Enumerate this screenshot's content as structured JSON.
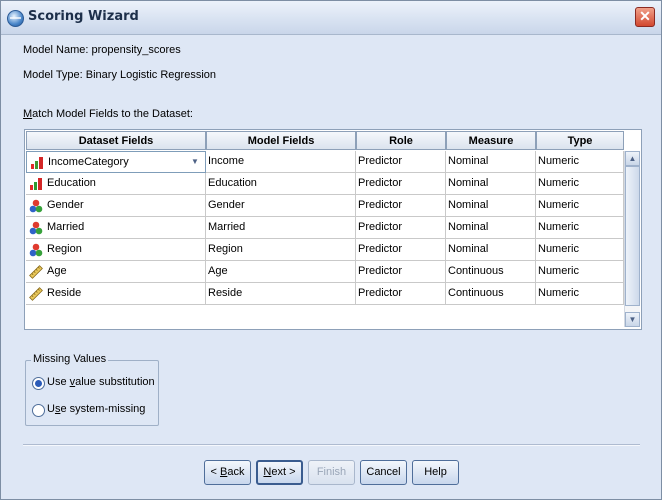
{
  "window": {
    "title": "Scoring Wizard",
    "close_label": "✕"
  },
  "info": {
    "model_name": "Model Name: propensity_scores",
    "model_type": "Model Type: Binary Logistic Regression",
    "match_prefix": "",
    "match_underlined": "M",
    "match_rest": "atch Model Fields to the Dataset:"
  },
  "table": {
    "headers": [
      "Dataset Fields",
      "Model Fields",
      "Role",
      "Measure",
      "Type"
    ],
    "rows": [
      {
        "dataset_field": "IncomeCategory",
        "model_field": "Income",
        "role": "Predictor",
        "measure": "Nominal",
        "type": "Numeric",
        "icon": "ordinal-bar-icon"
      },
      {
        "dataset_field": "Education",
        "model_field": "Education",
        "role": "Predictor",
        "measure": "Nominal",
        "type": "Numeric",
        "icon": "ordinal-bar-icon"
      },
      {
        "dataset_field": "Gender",
        "model_field": "Gender",
        "role": "Predictor",
        "measure": "Nominal",
        "type": "Numeric",
        "icon": "nominal-circles-icon"
      },
      {
        "dataset_field": "Married",
        "model_field": "Married",
        "role": "Predictor",
        "measure": "Nominal",
        "type": "Numeric",
        "icon": "nominal-circles-icon"
      },
      {
        "dataset_field": "Region",
        "model_field": "Region",
        "role": "Predictor",
        "measure": "Nominal",
        "type": "Numeric",
        "icon": "nominal-circles-icon"
      },
      {
        "dataset_field": "Age",
        "model_field": "Age",
        "role": "Predictor",
        "measure": "Continuous",
        "type": "Numeric",
        "icon": "scale-ruler-icon"
      },
      {
        "dataset_field": "Reside",
        "model_field": "Reside",
        "role": "Predictor",
        "measure": "Continuous",
        "type": "Numeric",
        "icon": "scale-ruler-icon"
      }
    ]
  },
  "missing_values": {
    "title": "Missing Values",
    "option1_pre": "Use ",
    "option1_u": "v",
    "option1_post": "alue substitution",
    "option2_pre": "U",
    "option2_u": "s",
    "option2_post": "e system-missing",
    "selected": "Use value substitution"
  },
  "buttons": {
    "back_arrow": "<",
    "back_u": "B",
    "back_rest": "ack",
    "next_u": "N",
    "next_rest": "ext",
    "next_arrow": ">",
    "finish": "Finish",
    "cancel": "Cancel",
    "help": "Help"
  },
  "colors": {
    "background": "#dee7f5",
    "accent": "#2b5bb8"
  }
}
